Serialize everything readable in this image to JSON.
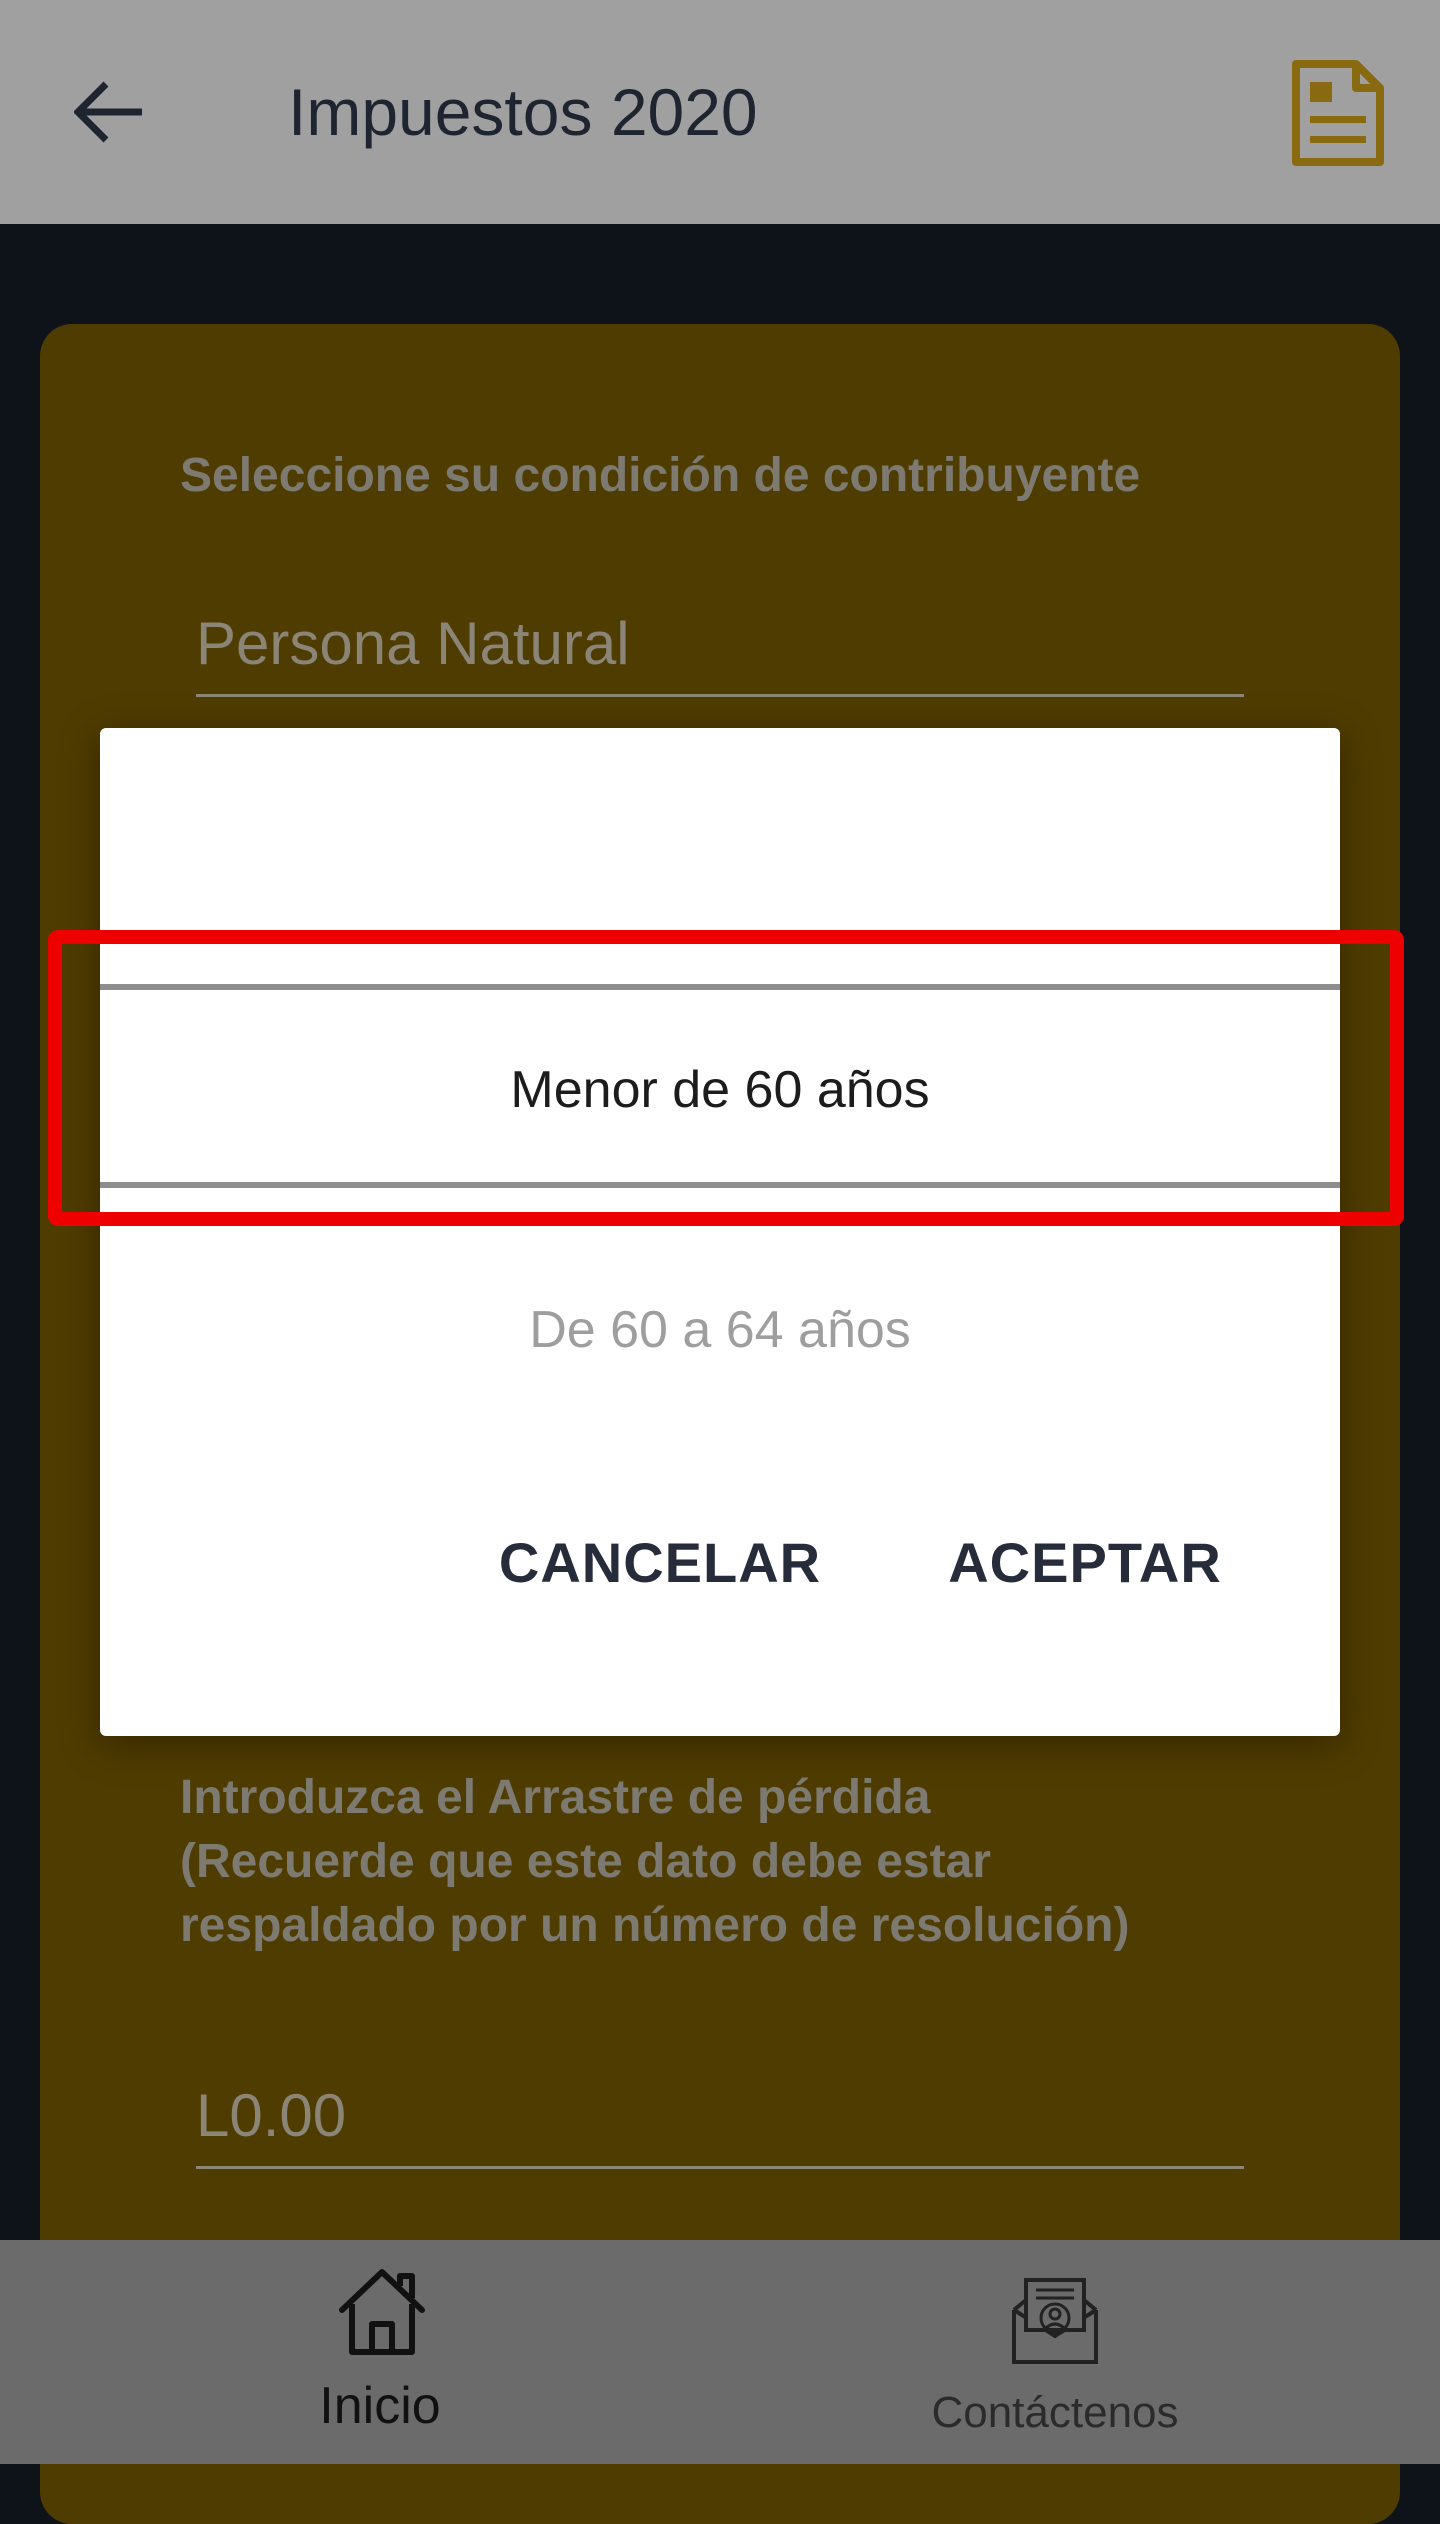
{
  "appbar": {
    "title": "Impuestos 2020",
    "back_icon": "arrow-left-icon",
    "action_icon": "document-icon",
    "accent_color": "#8a6a10"
  },
  "form": {
    "condition_label": "Seleccione su condición de contribuyente",
    "condition_value": "Persona Natural",
    "loss_label_line1": "Introduzca el Arrastre de pérdida",
    "loss_label_line2": "(Recuerde que este dato debe estar",
    "loss_label_line3": "respaldado por un número de resolución)",
    "loss_value": "L0.00"
  },
  "dialog": {
    "options": [
      "Menor de 60 años",
      "De 60 a 64 años"
    ],
    "selected": "Menor de 60 años",
    "cancel_label": "CANCELAR",
    "accept_label": "ACEPTAR",
    "highlight_color": "#ee0000"
  },
  "bottom_nav": {
    "items": [
      {
        "label": "Inicio",
        "icon": "home-icon",
        "active": true
      },
      {
        "label": "Contáctenos",
        "icon": "contact-icon",
        "active": false
      }
    ]
  }
}
